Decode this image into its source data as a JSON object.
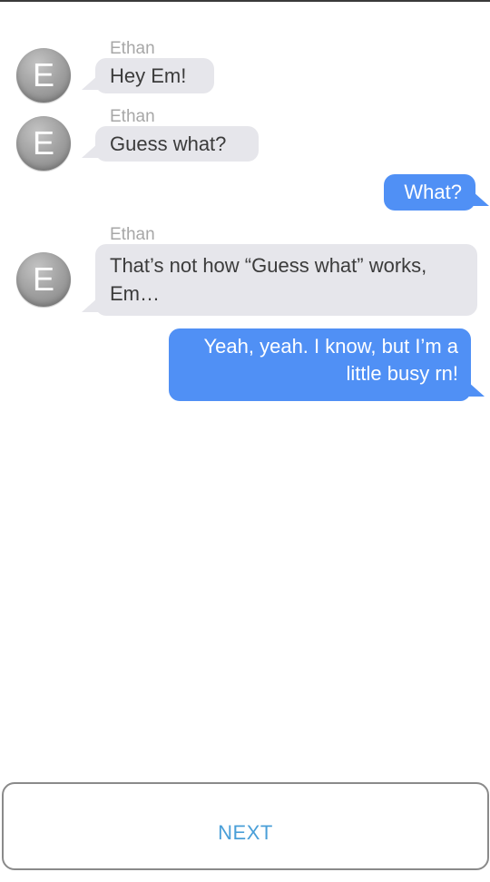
{
  "conversation": {
    "messages": [
      {
        "direction": "incoming",
        "sender": "Ethan",
        "avatar_letter": "E",
        "text": "Hey Em!"
      },
      {
        "direction": "incoming",
        "sender": "Ethan",
        "avatar_letter": "E",
        "text": "Guess what?"
      },
      {
        "direction": "outgoing",
        "text": "What?"
      },
      {
        "direction": "incoming",
        "sender": "Ethan",
        "avatar_letter": "E",
        "lines": [
          "That’s not how “Guess what” works,",
          "Em…"
        ]
      },
      {
        "direction": "outgoing",
        "lines": [
          "Yeah, yeah. I know, but I’m a",
          "little busy rn!"
        ]
      }
    ]
  },
  "footer": {
    "next_label": "NEXT"
  },
  "colors": {
    "incoming_bubble": "#e6e6eb",
    "outgoing_bubble": "#5090f5",
    "next_text": "#4a9fd8",
    "sender_name": "#a7a7a7"
  },
  "icons": {
    "avatar": "letter-avatar"
  }
}
